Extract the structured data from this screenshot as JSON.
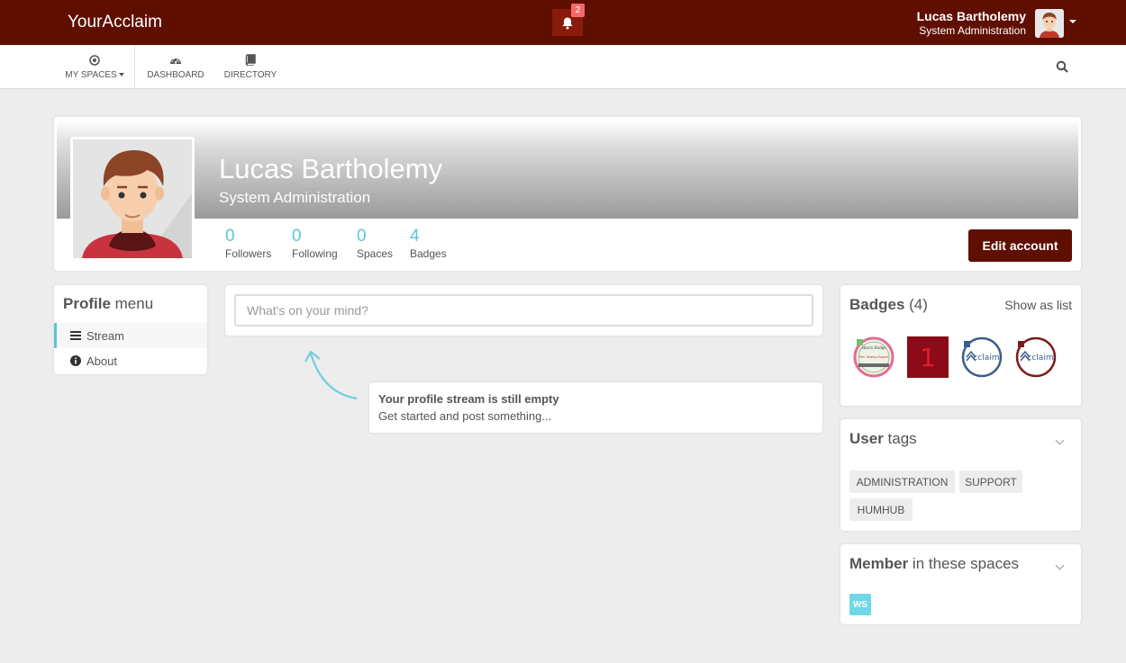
{
  "topbar": {
    "brand": "YourAcclaim",
    "notification_count": "2",
    "user_name": "Lucas Bartholemy",
    "user_role": "System Administration"
  },
  "subnav": {
    "items": [
      {
        "label": "MY SPACES",
        "icon": "dot-circle-icon"
      },
      {
        "label": "DASHBOARD",
        "icon": "dashboard-icon"
      },
      {
        "label": "DIRECTORY",
        "icon": "book-icon"
      }
    ]
  },
  "profile": {
    "name": "Lucas Bartholemy",
    "title": "System Administration",
    "stats": [
      {
        "value": "0",
        "label": "Followers"
      },
      {
        "value": "0",
        "label": "Following"
      },
      {
        "value": "0",
        "label": "Spaces"
      },
      {
        "value": "4",
        "label": "Badges"
      }
    ],
    "edit_label": "Edit account"
  },
  "profile_menu": {
    "title_bold": "Profile",
    "title_rest": " menu",
    "items": [
      {
        "label": "Stream",
        "icon": "bars-icon"
      },
      {
        "label": "About",
        "icon": "info-circle-icon"
      }
    ]
  },
  "stream": {
    "placeholder": "What's on your mind?",
    "empty_title": "Your profile stream is still empty",
    "empty_sub": "Get started and post something..."
  },
  "badges": {
    "title_bold": "Badges",
    "count": " (4)",
    "show_as_list": "Show as list",
    "items": [
      {
        "label": "Pen Testing Expert",
        "header": "ebacio Badge"
      },
      {
        "label": "1"
      },
      {
        "label": "cclaim"
      },
      {
        "label": "cclaim"
      }
    ]
  },
  "user_tags": {
    "title_bold": "User",
    "title_rest": " tags",
    "tags": [
      "ADMINISTRATION",
      "SUPPORT",
      "HUMHUB"
    ]
  },
  "member_spaces": {
    "title_bold": "Member",
    "title_rest": " in these spaces",
    "spaces": [
      "WS"
    ]
  },
  "colors": {
    "brand": "#5f0f00",
    "accent": "#5bc6d8"
  }
}
